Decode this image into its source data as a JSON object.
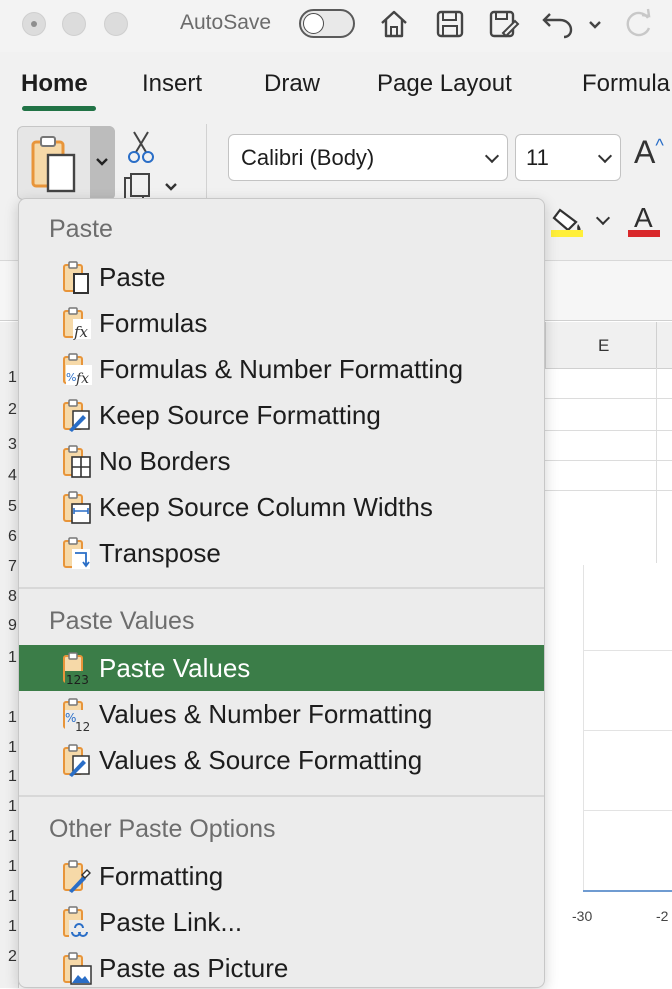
{
  "titlebar": {
    "autosave_label": "AutoSave"
  },
  "tabs": [
    {
      "label": "Home",
      "active": true
    },
    {
      "label": "Insert",
      "active": false
    },
    {
      "label": "Draw",
      "active": false
    },
    {
      "label": "Page Layout",
      "active": false
    },
    {
      "label": "Formula",
      "active": false
    }
  ],
  "ribbon": {
    "font_name": "Calibri (Body)",
    "font_size": "11",
    "grow_font_glyph": "A",
    "font_color_glyph": "A"
  },
  "sheet": {
    "column_label": "E",
    "row_numbers": [
      "1",
      "2",
      "3",
      "4",
      "5",
      "6",
      "7",
      "8",
      "9",
      "1",
      "1",
      "1",
      "1",
      "1",
      "1",
      "1",
      "1",
      "1",
      "2"
    ],
    "chart_ticks": [
      "-30",
      "-2"
    ]
  },
  "menu": {
    "sections": [
      {
        "title": "Paste",
        "items": [
          {
            "label": "Paste",
            "icon": "paste-icon"
          },
          {
            "label": "Formulas",
            "icon": "paste-formulas-icon"
          },
          {
            "label": "Formulas & Number Formatting",
            "icon": "paste-formulas-number-formatting-icon"
          },
          {
            "label": "Keep Source Formatting",
            "icon": "paste-keep-source-formatting-icon"
          },
          {
            "label": "No Borders",
            "icon": "paste-no-borders-icon"
          },
          {
            "label": "Keep Source Column Widths",
            "icon": "paste-keep-column-widths-icon"
          },
          {
            "label": "Transpose",
            "icon": "paste-transpose-icon"
          }
        ]
      },
      {
        "title": "Paste Values",
        "items": [
          {
            "label": "Paste Values",
            "icon": "paste-values-icon",
            "selected": true
          },
          {
            "label": "Values & Number Formatting",
            "icon": "paste-values-number-formatting-icon"
          },
          {
            "label": "Values & Source Formatting",
            "icon": "paste-values-source-formatting-icon"
          }
        ]
      },
      {
        "title": "Other Paste Options",
        "items": [
          {
            "label": "Formatting",
            "icon": "paste-formatting-icon"
          },
          {
            "label": "Paste Link...",
            "icon": "paste-link-icon"
          },
          {
            "label": "Paste as Picture",
            "icon": "paste-as-picture-icon"
          }
        ]
      }
    ]
  },
  "colors": {
    "accent_green": "#217346",
    "selected_green": "#3b7d48",
    "clipboard_orange": "#e8953a",
    "highlight_yellow": "#ffef3a",
    "font_red": "#d9282b"
  }
}
